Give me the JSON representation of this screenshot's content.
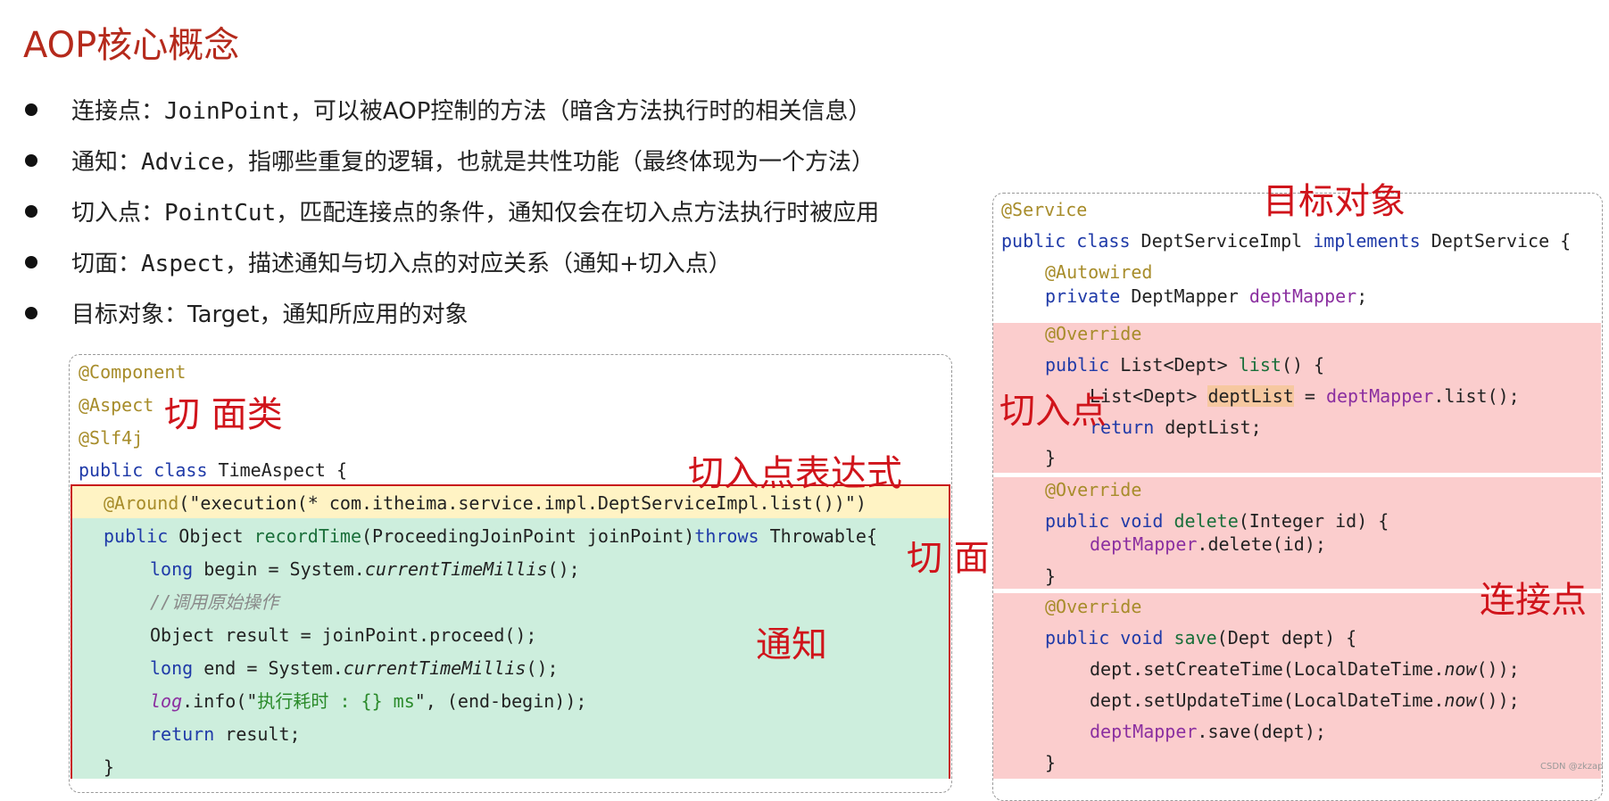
{
  "title": "AOP核心概念",
  "bullets": [
    {
      "label": "连接点：",
      "term": "JoinPoint",
      "desc": "，可以被AOP控制的方法（暗含方法执行时的相关信息）"
    },
    {
      "label": "通知：",
      "term": "Advice",
      "desc": "，指哪些重复的逻辑，也就是共性功能（最终体现为一个方法）"
    },
    {
      "label": "切入点：",
      "term": "PointCut",
      "desc": "，匹配连接点的条件，通知仅会在切入点方法执行时被应用"
    },
    {
      "label": "切面：",
      "term": "Aspect",
      "desc": "，描述通知与切入点的对应关系（通知+切入点）"
    },
    {
      "label": "目标对象：Target，通知所应用的对象",
      "term": "",
      "desc": ""
    }
  ],
  "left_code": {
    "component": "@Component",
    "aspect": "@Aspect",
    "slf4j": "@Slf4j",
    "class_kw": "public class",
    "class_name": "TimeAspect {",
    "around_anno": "@Around",
    "around_open": "(\"",
    "around_expr": "execution(* com.itheima.service.impl.DeptServiceImpl.list())",
    "around_close": "\")",
    "m_public": "public",
    "m_ret": "Object",
    "m_name": "recordTime",
    "m_params": "(ProceedingJoinPoint joinPoint)",
    "m_throws": "throws",
    "m_exc": "Throwable{",
    "l1_kw": "long",
    "l1_rest": "begin = System.",
    "l1_call": "currentTimeMillis",
    "l1_end": "();",
    "comment": "//调用原始操作",
    "l3": "Object result = joinPoint.proceed();",
    "l4_kw": "long",
    "l4_rest": "end = System.",
    "l4_call": "currentTimeMillis",
    "l4_end": "();",
    "l5_log": "log",
    "l5_mid": ".info(\"",
    "l5_str": "执行耗时 : {} ms",
    "l5_end": "\", (end-begin));",
    "ret_kw": "return",
    "ret_rest": "result;",
    "close_brace": "}"
  },
  "right_code": {
    "service": "@Service",
    "cls_kw1": "public class",
    "cls_name": "DeptServiceImpl",
    "cls_kw2": "implements",
    "cls_iface": "DeptService {",
    "autowired": "@Autowired",
    "field_kw": "private",
    "field_type": "DeptMapper",
    "field_var": "deptMapper",
    "field_end": ";",
    "override": "@Override",
    "list_kw": "public",
    "list_sig": "List<Dept>",
    "list_name": "list",
    "list_end": "() {",
    "list_l1a": "List<Dept>",
    "list_l1var": "deptList",
    "list_l1b": "=",
    "list_l1c": "deptMapper",
    "list_l1d": ".list();",
    "list_ret_kw": "return",
    "list_ret_rest": "deptList;",
    "brace": "}",
    "del_kw": "public void",
    "del_name": "delete",
    "del_params": "(Integer id) {",
    "del_l1a": "deptMapper",
    "del_l1b": ".delete(id);",
    "save_kw": "public void",
    "save_name": "save",
    "save_params": "(Dept dept) {",
    "save_l1a": "dept.setCreateTime(LocalDateTime.",
    "save_l1b": "now",
    "save_l1c": "());",
    "save_l2a": "dept.setUpdateTime(LocalDateTime.",
    "save_l2b": "now",
    "save_l2c": "());",
    "save_l3a": "deptMapper",
    "save_l3b": ".save(dept);"
  },
  "labels": {
    "aspect_class": "切 面类",
    "pointcut_expr": "切入点表达式",
    "aspect": "切 面",
    "advice": "通知",
    "target": "目标对象",
    "pointcut": "切入点",
    "joinpoint": "连接点"
  },
  "watermark": "CSDN @zkzap",
  "colors": {
    "title": "#b52a1c",
    "label_red": "#d0141b",
    "advice_bg": "#cdeedd",
    "joinpoint_bg": "#fbcdcd",
    "pointcut_expr_bg": "#fff3c4",
    "highlight": "#f6c8a0"
  }
}
